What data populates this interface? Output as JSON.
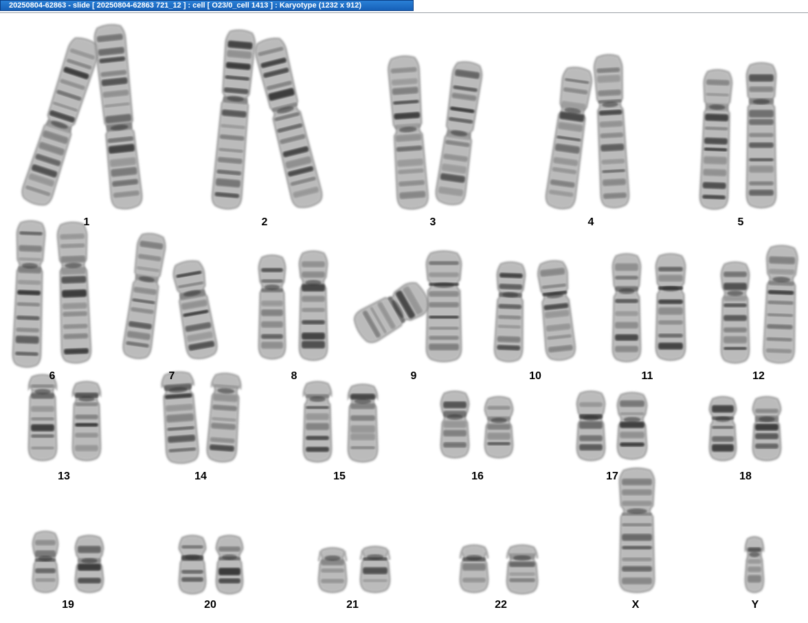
{
  "window": {
    "title": "20250804-62863 - slide [ 20250804-62863 721_12 ] : cell [ O23/0_cell 1413 ] : Karyotype  (1232 x 912)"
  },
  "karyotype": {
    "groups": [
      {
        "label": "1"
      },
      {
        "label": "2"
      },
      {
        "label": "3"
      },
      {
        "label": "4"
      },
      {
        "label": "5"
      },
      {
        "label": "6"
      },
      {
        "label": "7"
      },
      {
        "label": "8"
      },
      {
        "label": "9"
      },
      {
        "label": "10"
      },
      {
        "label": "11"
      },
      {
        "label": "12"
      },
      {
        "label": "13"
      },
      {
        "label": "14"
      },
      {
        "label": "15"
      },
      {
        "label": "16"
      },
      {
        "label": "17"
      },
      {
        "label": "18"
      },
      {
        "label": "19"
      },
      {
        "label": "20"
      },
      {
        "label": "21"
      },
      {
        "label": "22"
      },
      {
        "label": "X"
      },
      {
        "label": "Y"
      }
    ]
  },
  "colors": {
    "chromatid_light": "#b8b8b8",
    "chromatid_mid": "#7a7a7a",
    "band_dark": "#2e2e2e",
    "background": "#ffffff",
    "titlebar": "#1f6fc8"
  }
}
